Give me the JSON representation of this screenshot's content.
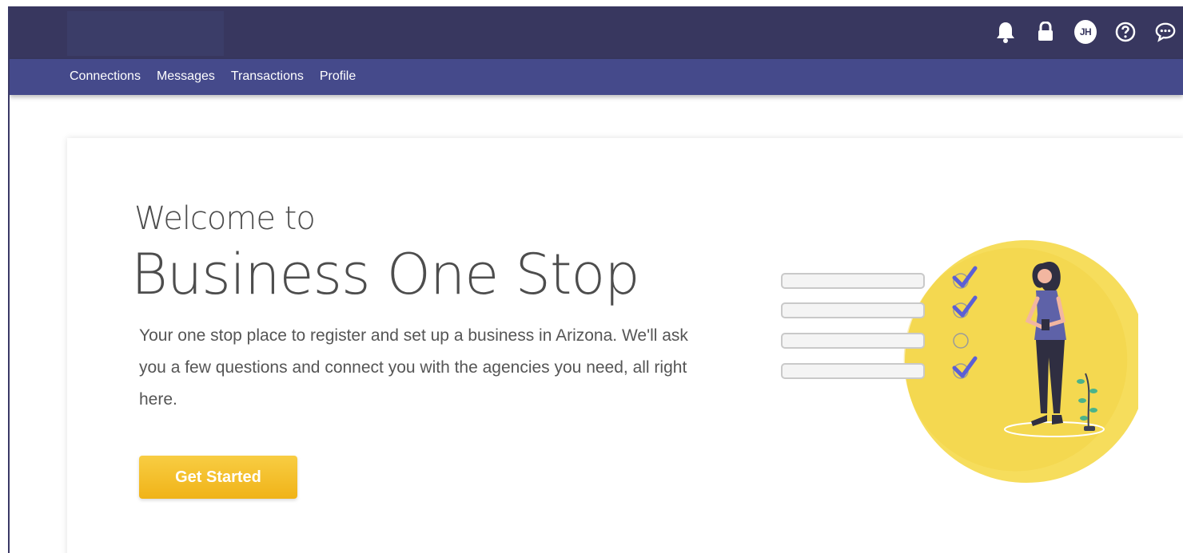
{
  "header": {
    "icons": [
      "bell-icon",
      "lock-icon",
      "avatar",
      "help-icon",
      "chat-icon"
    ],
    "avatar_initials": "JH"
  },
  "nav": {
    "items": [
      {
        "label": "Connections"
      },
      {
        "label": "Messages"
      },
      {
        "label": "Transactions"
      },
      {
        "label": "Profile"
      }
    ]
  },
  "hero": {
    "welcome": "Welcome to",
    "title": "Business One Stop",
    "intro": "Your one stop place to register and set up a business in Arizona. We'll ask you a few questions and connect you with the agencies you need, all right here.",
    "cta_label": "Get Started"
  },
  "colors": {
    "topbar": "#38375f",
    "navbar": "#454a8b",
    "cta": "#f5c12e",
    "accent_circle": "#f6dd5c",
    "check": "#5b5fd6"
  }
}
